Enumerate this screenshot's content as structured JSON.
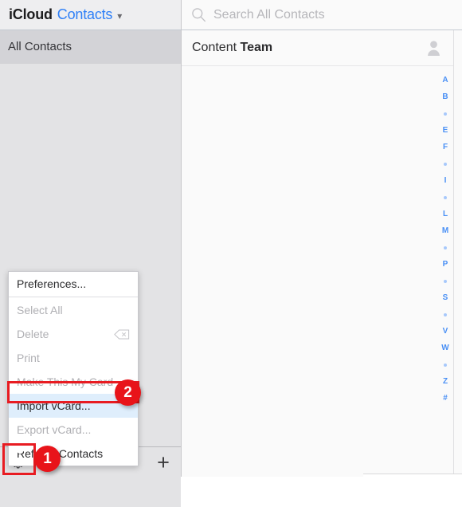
{
  "window": {
    "brand_name": "iCloud",
    "app_name": "Contacts",
    "app_chevron": "chevron-down"
  },
  "sidebar": {
    "groups": [
      {
        "label": "All Contacts",
        "selected": true
      }
    ],
    "toolbar": {
      "settings_label": "gear-icon",
      "add_label": "+"
    }
  },
  "context_menu": {
    "items": [
      {
        "label": "Preferences...",
        "disabled": false,
        "separator_after": true,
        "highlighted": false,
        "shortcut": ""
      },
      {
        "label": "Select All",
        "disabled": true,
        "separator_after": false,
        "highlighted": false,
        "shortcut": ""
      },
      {
        "label": "Delete",
        "disabled": true,
        "separator_after": false,
        "highlighted": false,
        "shortcut": "⌫"
      },
      {
        "label": "Print",
        "disabled": true,
        "separator_after": false,
        "highlighted": false,
        "shortcut": ""
      },
      {
        "label": "Make This My Card",
        "disabled": true,
        "separator_after": false,
        "highlighted": false,
        "shortcut": ""
      },
      {
        "label": "Import vCard...",
        "disabled": false,
        "separator_after": false,
        "highlighted": true,
        "shortcut": ""
      },
      {
        "label": "Export vCard...",
        "disabled": true,
        "separator_after": false,
        "highlighted": false,
        "shortcut": ""
      },
      {
        "label": "Refresh Contacts",
        "disabled": false,
        "separator_after": false,
        "highlighted": false,
        "shortcut": ""
      }
    ]
  },
  "annotations": {
    "callout_1": "1",
    "callout_2": "2",
    "highlight_color": "#e8141a"
  },
  "search": {
    "placeholder": "Search All Contacts",
    "value": "",
    "icon": "search-icon"
  },
  "contacts": {
    "rows": [
      {
        "first_name": "Content",
        "last_name": "Team",
        "avatar": "person-icon"
      }
    ]
  },
  "alpha_index": {
    "entries": [
      "A",
      "B",
      "•",
      "E",
      "F",
      "•",
      "I",
      "•",
      "L",
      "M",
      "•",
      "P",
      "•",
      "S",
      "•",
      "V",
      "W",
      "•",
      "Z",
      "#"
    ],
    "color": "#4a90f5"
  }
}
